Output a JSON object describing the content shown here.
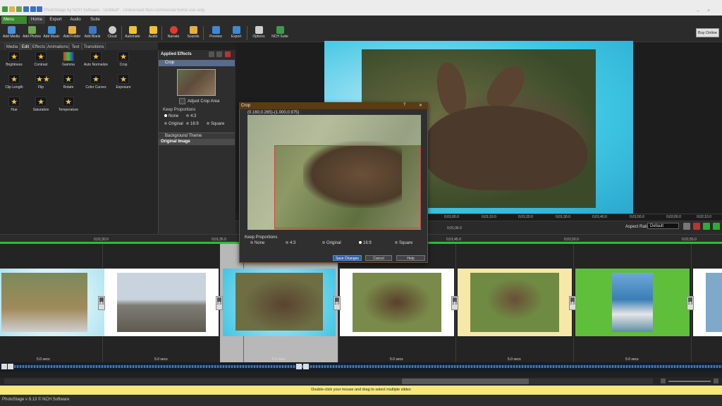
{
  "app": {
    "title": "PhotoStage by NCH Software - Untitled* - Unlicensed Non-commercial home use only",
    "status_text": "PhotoStage v 8.13 © NCH Software"
  },
  "ribbon_tabs": [
    {
      "label": "Menu"
    },
    {
      "label": "Home"
    },
    {
      "label": "Export"
    },
    {
      "label": "Audio"
    },
    {
      "label": "Suite"
    }
  ],
  "ribbon_buttons": [
    {
      "label": "Add Media",
      "icon": "add-media-icon",
      "color": "#4f8fd6"
    },
    {
      "label": "Add Photos",
      "icon": "add-photos-icon",
      "color": "#6aa84f"
    },
    {
      "label": "Add Music",
      "icon": "add-music-icon",
      "color": "#3d8fd9"
    },
    {
      "label": "Add Folder",
      "icon": "add-folder-icon",
      "color": "#e6b03a"
    },
    {
      "label": "Add Blank",
      "icon": "add-blank-icon",
      "color": "#3a78c4"
    },
    {
      "label": "Cloud",
      "icon": "cloud-icon",
      "color": "#cccccc"
    },
    {
      "label": "Automate",
      "icon": "automate-icon",
      "color": "#f0c22e"
    },
    {
      "label": "Audio",
      "icon": "audio-icon",
      "color": "#f0c22e"
    },
    {
      "label": "Narrate",
      "icon": "narrate-icon",
      "color": "#e23b2e"
    },
    {
      "label": "Sounds",
      "icon": "sounds-icon",
      "color": "#e6b03a"
    },
    {
      "label": "Preview",
      "icon": "preview-icon",
      "color": "#3a8ad6"
    },
    {
      "label": "Export",
      "icon": "export-icon",
      "color": "#3a8ad6"
    },
    {
      "label": "Options",
      "icon": "options-icon",
      "color": "#cfcfcf"
    },
    {
      "label": "NCH Suite",
      "icon": "nch-suite-icon",
      "color": "#3a9c4a"
    }
  ],
  "buy_online": "Buy Online",
  "sub_tabs": [
    {
      "label": "Media",
      "active": false
    },
    {
      "label": "Edit",
      "active": true
    },
    {
      "label": "Effects",
      "active": false
    },
    {
      "label": "Animations",
      "active": false
    },
    {
      "label": "Text",
      "active": false
    },
    {
      "label": "Transitions",
      "active": false
    }
  ],
  "effects": [
    {
      "label": "Brightness"
    },
    {
      "label": "Contrast"
    },
    {
      "label": "Gamma"
    },
    {
      "label": "Auto Normalize"
    },
    {
      "label": "Crop"
    },
    {
      "label": "Clip Length"
    },
    {
      "label": "Flip"
    },
    {
      "label": "Rotate"
    },
    {
      "label": "Color Curves"
    },
    {
      "label": "Exposure"
    },
    {
      "label": "Hue"
    },
    {
      "label": "Saturation"
    },
    {
      "label": "Temperature"
    }
  ],
  "applied_effects": {
    "title": "Applied Effects",
    "crop_label": "Crop",
    "adjust_label": "Adjust Crop Area",
    "keep_proportions": "Keep Proportions",
    "options": [
      "None",
      "4:3",
      "Original",
      "16:9",
      "Square"
    ],
    "selected": "None",
    "background_theme": "Background Theme",
    "original_image": "Original Image"
  },
  "preview": {
    "ruler_ticks": [
      "0;01;00.0",
      "0;01;10.0",
      "0;01;20.0",
      "0;01;30.0",
      "0;01;40.0",
      "0;01;50.0",
      "0;02;00.0",
      "0;02;10.0"
    ],
    "current_time": "0;01;36.0",
    "aspect_label": "Aspect Ratio:",
    "aspect_value": "Default"
  },
  "timeline_ruler": [
    "0;01;30.0",
    "0;01;35.0",
    "0;01;45.0",
    "0;01;50.0",
    "0;01;55.0"
  ],
  "slides": [
    {
      "duration": "5.0 secs"
    },
    {
      "duration": "5.0 secs"
    },
    {
      "duration": "5.0 secs"
    },
    {
      "duration": "5.0 secs"
    },
    {
      "duration": "5.0 secs"
    },
    {
      "duration": "5.0 secs"
    }
  ],
  "transition_label": "2.0",
  "hint": "Double-click your mouse and drag to select multiple slides",
  "crop_dialog": {
    "title": "Crop",
    "help_glyph": "?",
    "close_glyph": "✕",
    "coords": "(0.160,0.265)-(1.000,0.975)",
    "keep_proportions": "Keep Proportions",
    "options": [
      "None",
      "4:3",
      "Original",
      "16:9",
      "Square"
    ],
    "selected": "16:9",
    "save_label": "Save Changes",
    "cancel_label": "Cancel",
    "help_label": "Help"
  },
  "colors": {
    "accent_green": "#2fbb3b",
    "hint_yellow": "#f7e87a",
    "dialog_title": "#5b3b12",
    "selected_row": "#5a6b8c"
  }
}
